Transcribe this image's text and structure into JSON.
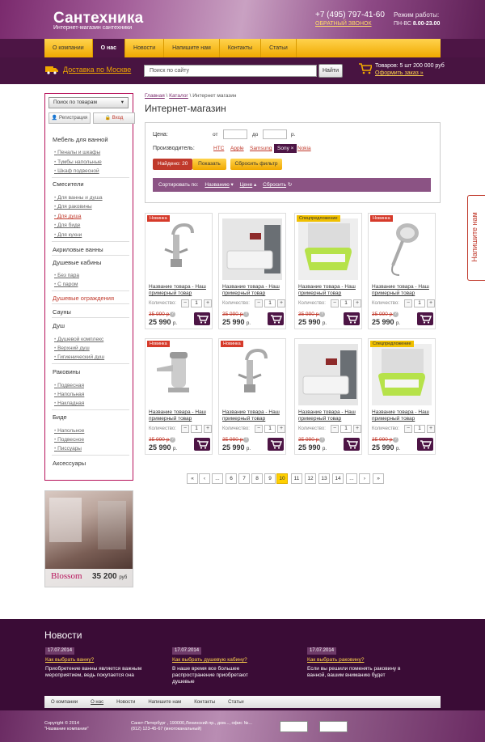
{
  "header": {
    "logo": "Сантехника",
    "tagline": "Интернет-магазин сантехники",
    "phone": "+7 (495) 797-41-60",
    "callback": "ОБРАТНЫЙ ЗВОНОК",
    "work_label": "Режим работы:",
    "work_days": "ПН-ВС",
    "work_time": "8.00-23.00"
  },
  "nav": [
    "О компании",
    "О нас",
    "Новости",
    "Напишите нам",
    "Контакты",
    "Статьи"
  ],
  "search": {
    "delivery": "Доставка по Москве",
    "placeholder": "Поиск по сайту",
    "button": "Найти",
    "goods": "Товаров: 5 шт 200 000 руб",
    "order": "Оформить заказ »"
  },
  "sidebar": {
    "search": "Поиск по товарам",
    "register": "Регистрация",
    "login": "Вход",
    "cats": {
      "c1": "Мебель для ванной",
      "c1s": [
        "Пеналы и шкафы",
        "Тумбы напольные",
        "Шкаф подвесной"
      ],
      "c2": "Смесители",
      "c2s": [
        "Для ванны и душа",
        "Для раковины",
        "Для душа",
        "Для биде",
        "Для кухни"
      ],
      "c3": "Акриловые ванны",
      "c4": "Душевые кабины",
      "c4s": [
        "Без пара",
        "С паром"
      ],
      "c5": "Душевые ограждения",
      "c6": "Сауны",
      "c7": "Душ",
      "c7s": [
        "Душевой комплекс",
        "Верхний душ",
        "Гигиенический душ"
      ],
      "c8": "Раковины",
      "c8s": [
        "Подвесная",
        "Напольная",
        "Накладная"
      ],
      "c9": "Биде",
      "c9s": [
        "Напольное",
        "Подвесное",
        "Писсуары"
      ],
      "c10": "Аксессуары"
    }
  },
  "banner": {
    "name": "Blossom",
    "price": "35 200",
    "currency": "руб"
  },
  "breadcrumb": [
    "Главная",
    "Каталог",
    "Интернет магазин"
  ],
  "page_title": "Интернет-магазин",
  "filter": {
    "price_label": "Цена:",
    "from": "от",
    "to": "до",
    "currency": "р.",
    "maker_label": "Производитель:",
    "brands": [
      "HTC",
      "Apple",
      "Samsung",
      "Sony",
      "Nokia"
    ],
    "active_brand": "Sony",
    "found": "Найдено: 20",
    "show": "Показать",
    "reset": "Сбросить фильтр",
    "sort_label": "Сортировать по:",
    "sort_name": "Названию",
    "sort_price": "Цене",
    "sort_reset": "Сбросить"
  },
  "product": {
    "name": "Название товара - Наш примерный товар",
    "qty_label": "Количество:",
    "qty": "1",
    "old_price": "35 990 р.",
    "price": "25 990",
    "currency": "р."
  },
  "badges": {
    "new": "Новинка",
    "special": "Спецпредложение"
  },
  "pagination": [
    "«",
    "‹",
    "...",
    "6",
    "7",
    "8",
    "9",
    "10",
    "11",
    "12",
    "13",
    "14",
    "...",
    "›",
    "»"
  ],
  "feedback": "Напишите нам",
  "news": {
    "title": "Новости",
    "items": [
      {
        "date": "17.07.2014",
        "title": "Как выбрать ванну?",
        "text": "Приобретение ванны является важным мероприятием, ведь покупается она"
      },
      {
        "date": "17.07.2014",
        "title": "Как выбрать душевую кабину?",
        "text": "В наше время все большее распространение приобретают душевые"
      },
      {
        "date": "17.07.2014",
        "title": "Как выбрать раковину?",
        "text": "Если вы решили поменять раковину в ванной, вашим вниманию будет"
      }
    ]
  },
  "footer_nav": [
    "О компании",
    "О нас",
    "Новости",
    "Напишите нам",
    "Контакты",
    "Статьи"
  ],
  "footer": {
    "copy1": "Copyright © 2014",
    "copy2": "\"Название компании\"",
    "addr1": "Санкт-Петербург , 190000,Ленинский пр., дом..., офис №...",
    "addr2": "(812) 123-45-67 (многоканальный)"
  },
  "colors": {
    "brand_purple": "#4d1545",
    "accent_yellow": "#f0a800",
    "red": "#c0392b"
  }
}
